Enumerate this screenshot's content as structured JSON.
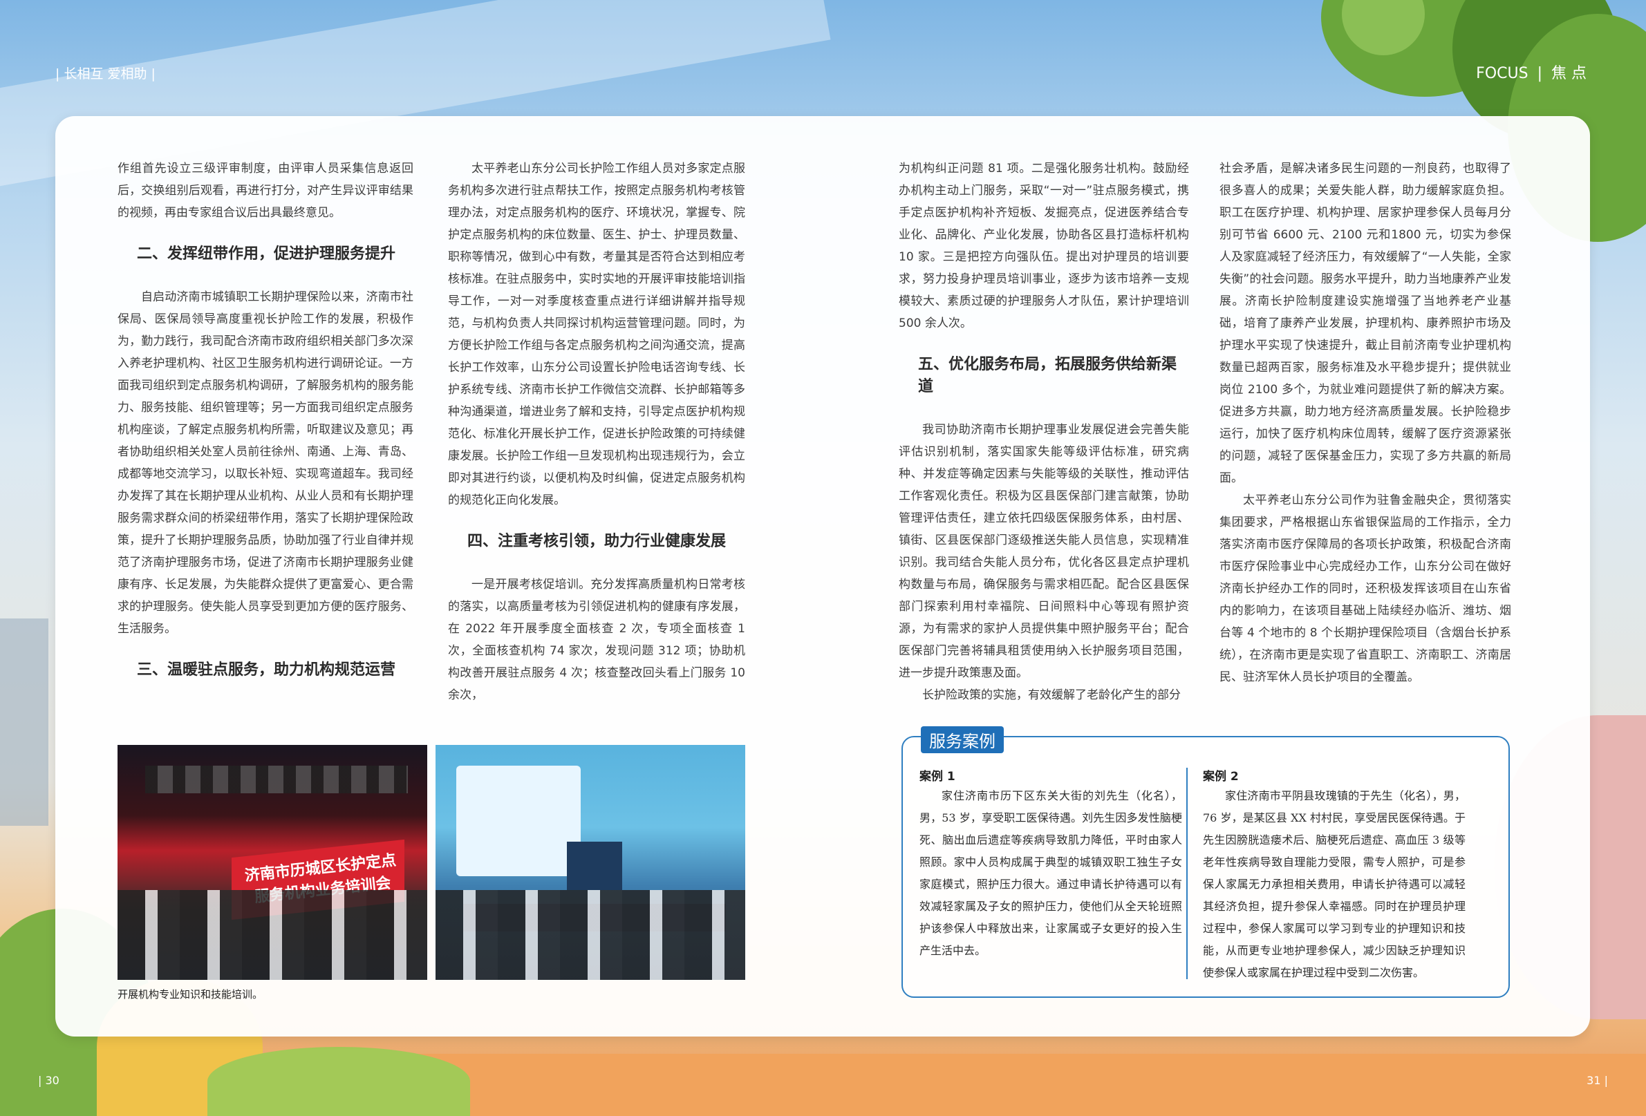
{
  "header": {
    "left": "| 长相互  爱相助 |",
    "right_en": "FOCUS",
    "right_sep": "|",
    "right_cn": "焦 点"
  },
  "page_numbers": {
    "left": "| 30",
    "right": "31 |"
  },
  "columns": {
    "c1": {
      "p1": "作组首先设立三级评审制度，由评审人员采集信息返回后，交换组别后观看，再进行打分，对产生异议评审结果的视频，再由专家组合议后出具最终意见。",
      "h2": "二、发挥纽带作用，促进护理服务提升",
      "p2": "自启动济南市城镇职工长期护理保险以来，济南市社保局、医保局领导高度重视长护险工作的发展，积极作为，勤力践行，我司配合济南市政府组织相关部门多次深入养老护理机构、社区卫生服务机构进行调研论证。一方面我司组织到定点服务机构调研，了解服务机构的服务能力、服务技能、组织管理等；另一方面我司组织定点服务机构座谈，了解定点服务机构所需，听取建议及意见；再者协助组织相关处室人员前往徐州、南通、上海、青岛、成都等地交流学习，以取长补短、实现弯道超车。我司经办发挥了其在长期护理从业机构、从业人员和有长期护理服务需求群众间的桥梁纽带作用，落实了长期护理保险政策，提升了长期护理服务品质，协助加强了行业自律并规范了济南护理服务市场，促进了济南市长期护理服务业健康有序、长足发展，为失能群众提供了更富爱心、更合需求的护理服务。使失能人员享受到更加方便的医疗服务、生活服务。",
      "h3": "三、温暖驻点服务，助力机构规范运营"
    },
    "c2": {
      "p1": "太平养老山东分公司长护险工作组人员对多家定点服务机构多次进行驻点帮扶工作，按照定点服务机构考核管理办法，对定点服务机构的医疗、环境状况，掌握专、院护定点服务机构的床位数量、医生、护士、护理员数量、职称等情况，做到心中有数，考量其是否符合达到相应考核标准。在驻点服务中，实时实地的开展评审技能培训指导工作，一对一对季度核查重点进行详细讲解并指导规范，与机构负责人共同探讨机构运营管理问题。同时，为方便长护险工作组与各定点服务机构之间沟通交流，提高长护工作效率，山东分公司设置长护险电话咨询专线、长护系统专线、济南市长护工作微信交流群、长护邮箱等多种沟通渠道，增进业务了解和支持，引导定点医护机构规范化、标准化开展长护工作，促进长护险政策的可持续健康发展。长护险工作组一旦发现机构出现违规行为，会立即对其进行约谈，以便机构及时纠偏，促进定点服务机构的规范化正向化发展。",
      "h4": "四、注重考核引领，助力行业健康发展",
      "p2": "一是开展考核促培训。充分发挥高质量机构日常考核的落实，以高质量考核为引领促进机构的健康有序发展，在 2022 年开展季度全面核查 2 次，专项全面核查 1 次，全面核查机构 74 家次，发现问题 312 项；协助机构改善开展驻点服务 4 次；核查整改回头看上门服务 10 余次，"
    },
    "c3": {
      "p1": "为机构纠正问题 81 项。二是强化服务壮机构。鼓励经办机构主动上门服务，采取“一对一”驻点服务模式，携手定点医护机构补齐短板、发掘亮点，促进医养结合专业化、品牌化、产业化发展，协助各区县打造标杆机构 10 家。三是把控方向强队伍。提出对护理员的培训要求，努力投身护理员培训事业，逐步为该市培养一支规模较大、素质过硬的护理服务人才队伍，累计护理培训 500 余人次。",
      "h5": "五、优化服务布局，拓展服务供给新渠道",
      "p2": "我司协助济南市长期护理事业发展促进会完善失能评估识别机制，落实国家失能等级评估标准，研究病种、并发症等确定因素与失能等级的关联性，推动评估工作客观化责任。积极为区县医保部门建言献策，协助管理评估责任，建立依托四级医保服务体系，由村居、镇街、区县医保部门逐级推送失能人员信息，实现精准识别。我司结合失能人员分布，优化各区县定点护理机构数量与布局，确保服务与需求相匹配。配合区县医保部门探索利用村幸福院、日间照料中心等现有照护资源，为有需求的家护人员提供集中照护服务平台；配合医保部门完善将辅具租赁使用纳入长护服务项目范围，进一步提升政策惠及面。",
      "p3": "长护险政策的实施，有效缓解了老龄化产生的部分"
    },
    "c4": {
      "p1": "社会矛盾，是解决诸多民生问题的一剂良药，也取得了很多喜人的成果；关爱失能人群，助力缓解家庭负担。职工在医疗护理、机构护理、居家护理参保人员每月分别可节省 6600 元、2100 元和1800 元，切实为参保人及家庭减轻了经济压力，有效缓解了“一人失能，全家失衡”的社会问题。服务水平提升，助力当地康养产业发展。济南长护险制度建设实施增强了当地养老产业基础，培育了康养产业发展，护理机构、康养照护市场及护理水平实现了快速提升，截止目前济南专业护理机构数量已超两百家，服务标准及水平稳步提升；提供就业岗位 2100 多个，为就业难问题提供了新的解决方案。促进多方共赢，助力地方经济高质量发展。长护险稳步运行，加快了医疗机构床位周转，缓解了医疗资源紧张的问题，减轻了医保基金压力，实现了多方共赢的新局面。",
      "p2": "太平养老山东分公司作为驻鲁金融央企，贯彻落实集团要求，严格根据山东省银保监局的工作指示，全力落实济南市医疗保障局的各项长护政策，积极配合济南市医疗保险事业中心完成经办工作，山东分公司在做好济南长护经办工作的同时，还积极发挥该项目在山东省内的影响力，在该项目基础上陆续经办临沂、潍坊、烟台等 4 个地市的 8 个长期护理保险项目（含烟台长护系统），在济南市更是实现了省直职工、济南职工、济南居民、驻济军休人员长护项目的全覆盖。"
    }
  },
  "photos": {
    "banner_text": "济南市历城区长护定点服务机构业务培训会",
    "caption": "开展机构专业知识和技能培训。"
  },
  "case_box": {
    "title": "服务案例",
    "case1": {
      "label": "案例 1",
      "text": "家住济南市历下区东关大街的刘先生（化名），男，53 岁，享受职工医保待遇。刘先生因多发性脑梗死、脑出血后遗症等疾病导致肌力降低，平时由家人照顾。家中人员构成属于典型的城镇双职工独生子女家庭模式，照护压力很大。通过申请长护待遇可以有效减轻家属及子女的照护压力，使他们从全天轮班照护该参保人中释放出来，让家属或子女更好的投入生产生活中去。"
    },
    "case2": {
      "label": "案例 2",
      "text": "家住济南市平阴县玫瑰镇的于先生（化名），男，76 岁，是某区县 XX 村村民，享受居民医保待遇。于先生因膀胱造瘘术后、脑梗死后遗症、高血压 3 级等老年性疾病导致自理能力受限，需专人照护，可是参保人家属无力承担相关费用，申请长护待遇可以减轻其经济负担，提升参保人幸福感。同时在护理员护理过程中，参保人家属可以学习到专业的护理知识和技能，从而更专业地护理参保人，减少因缺乏护理知识使参保人或家属在护理过程中受到二次伤害。"
    }
  },
  "colors": {
    "accent_blue": "#1f6fb8",
    "banner_red": "#d8232f"
  }
}
